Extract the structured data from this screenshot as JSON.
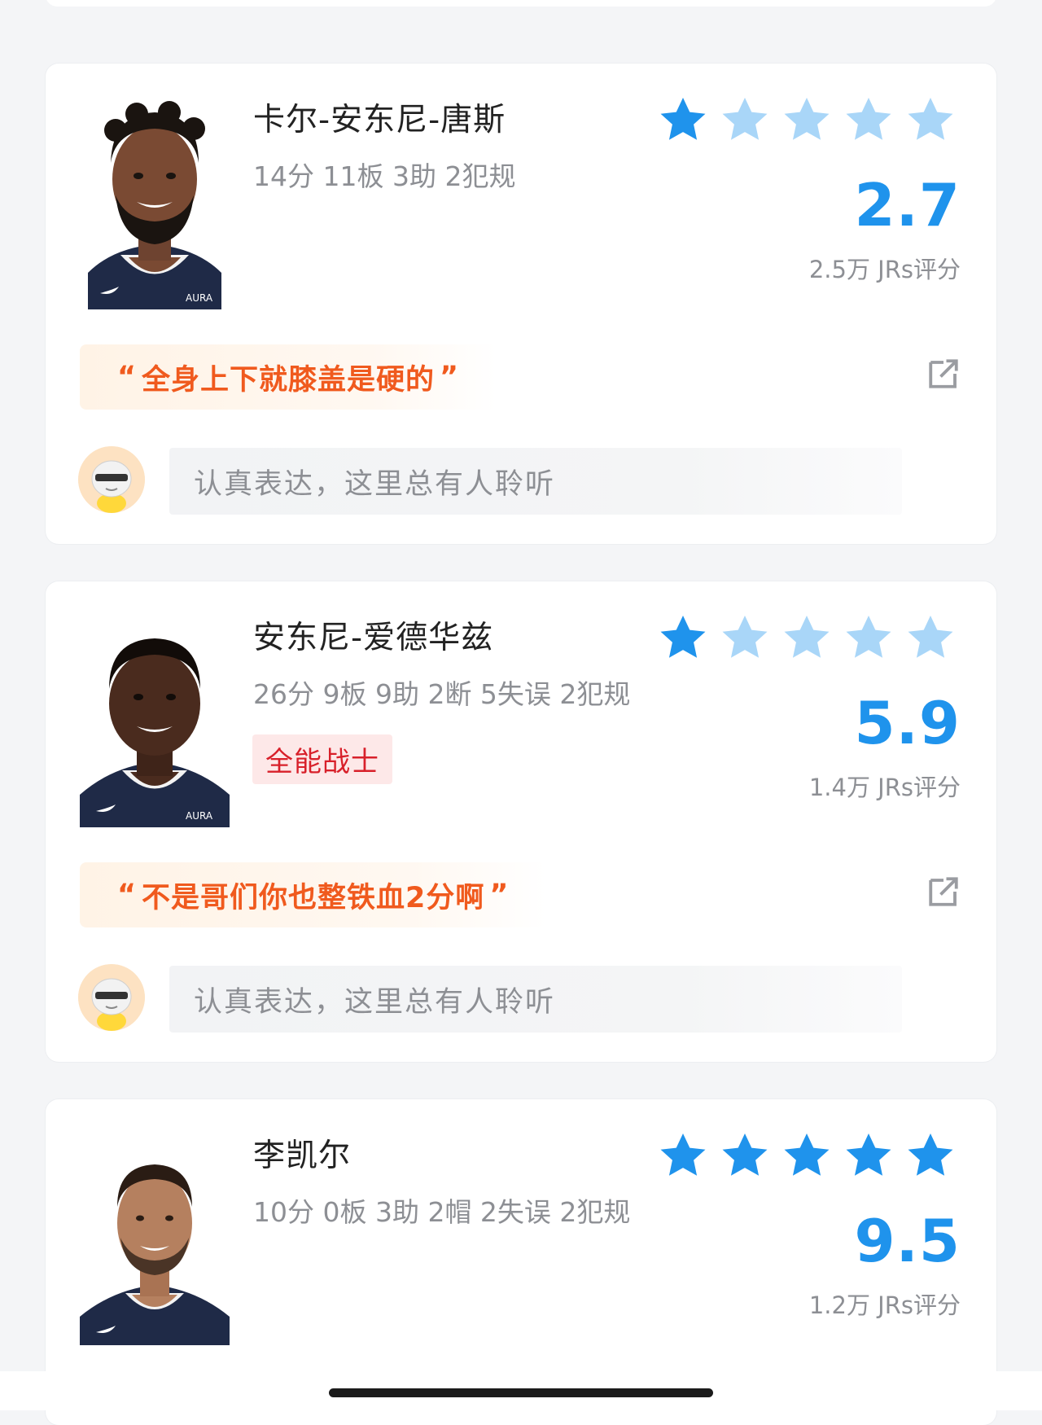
{
  "players": [
    {
      "name": "卡尔-安东尼-唐斯",
      "stats": "14分 11板 3助 2犯规",
      "tag": "",
      "rating_stars_filled": 1,
      "score": "2.7",
      "votes": "2.5万 JRs评分",
      "quote": "全身上下就膝盖是硬的",
      "comment_placeholder": "认真表达，这里总有人聆听"
    },
    {
      "name": "安东尼-爱德华兹",
      "stats": "26分 9板 9助 2断 5失误 2犯规",
      "tag": "全能战士",
      "rating_stars_filled": 1,
      "score": "5.9",
      "votes": "1.4万 JRs评分",
      "quote": "不是哥们你也整铁血2分啊",
      "comment_placeholder": "认真表达，这里总有人聆听"
    },
    {
      "name": "李凯尔",
      "stats": "10分 0板 3助 2帽 2失误 2犯规",
      "tag": "",
      "rating_stars_filled": 5,
      "score": "9.5",
      "votes": "1.2万 JRs评分"
    }
  ],
  "colors": {
    "accent_blue": "#1f93ec",
    "star_filled": "#1f93ec",
    "star_empty": "#a9d6f8",
    "quote_orange": "#f05a1e",
    "tag_red": "#d8202a"
  },
  "icons": [
    "star-icon",
    "share-icon",
    "user-avatar-icon",
    "player-photo"
  ]
}
